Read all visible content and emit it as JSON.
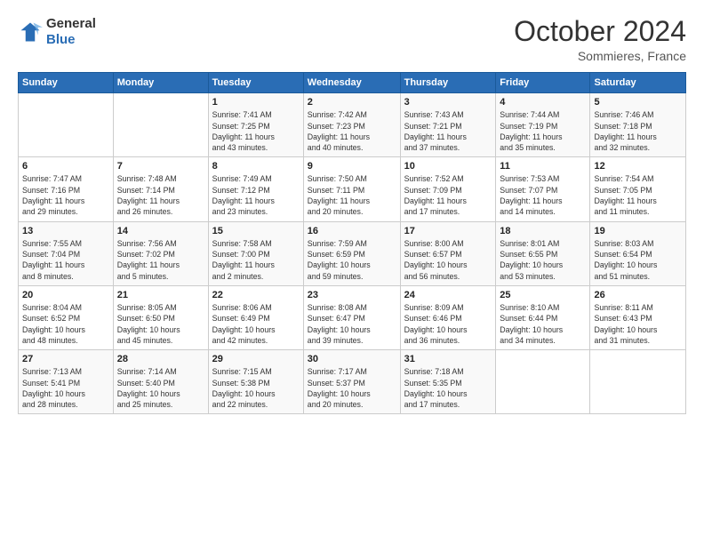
{
  "header": {
    "logo": {
      "general": "General",
      "blue": "Blue"
    },
    "title": "October 2024",
    "location": "Sommieres, France"
  },
  "days_of_week": [
    "Sunday",
    "Monday",
    "Tuesday",
    "Wednesday",
    "Thursday",
    "Friday",
    "Saturday"
  ],
  "weeks": [
    [
      {
        "day": "",
        "info": ""
      },
      {
        "day": "",
        "info": ""
      },
      {
        "day": "1",
        "info": "Sunrise: 7:41 AM\nSunset: 7:25 PM\nDaylight: 11 hours\nand 43 minutes."
      },
      {
        "day": "2",
        "info": "Sunrise: 7:42 AM\nSunset: 7:23 PM\nDaylight: 11 hours\nand 40 minutes."
      },
      {
        "day": "3",
        "info": "Sunrise: 7:43 AM\nSunset: 7:21 PM\nDaylight: 11 hours\nand 37 minutes."
      },
      {
        "day": "4",
        "info": "Sunrise: 7:44 AM\nSunset: 7:19 PM\nDaylight: 11 hours\nand 35 minutes."
      },
      {
        "day": "5",
        "info": "Sunrise: 7:46 AM\nSunset: 7:18 PM\nDaylight: 11 hours\nand 32 minutes."
      }
    ],
    [
      {
        "day": "6",
        "info": "Sunrise: 7:47 AM\nSunset: 7:16 PM\nDaylight: 11 hours\nand 29 minutes."
      },
      {
        "day": "7",
        "info": "Sunrise: 7:48 AM\nSunset: 7:14 PM\nDaylight: 11 hours\nand 26 minutes."
      },
      {
        "day": "8",
        "info": "Sunrise: 7:49 AM\nSunset: 7:12 PM\nDaylight: 11 hours\nand 23 minutes."
      },
      {
        "day": "9",
        "info": "Sunrise: 7:50 AM\nSunset: 7:11 PM\nDaylight: 11 hours\nand 20 minutes."
      },
      {
        "day": "10",
        "info": "Sunrise: 7:52 AM\nSunset: 7:09 PM\nDaylight: 11 hours\nand 17 minutes."
      },
      {
        "day": "11",
        "info": "Sunrise: 7:53 AM\nSunset: 7:07 PM\nDaylight: 11 hours\nand 14 minutes."
      },
      {
        "day": "12",
        "info": "Sunrise: 7:54 AM\nSunset: 7:05 PM\nDaylight: 11 hours\nand 11 minutes."
      }
    ],
    [
      {
        "day": "13",
        "info": "Sunrise: 7:55 AM\nSunset: 7:04 PM\nDaylight: 11 hours\nand 8 minutes."
      },
      {
        "day": "14",
        "info": "Sunrise: 7:56 AM\nSunset: 7:02 PM\nDaylight: 11 hours\nand 5 minutes."
      },
      {
        "day": "15",
        "info": "Sunrise: 7:58 AM\nSunset: 7:00 PM\nDaylight: 11 hours\nand 2 minutes."
      },
      {
        "day": "16",
        "info": "Sunrise: 7:59 AM\nSunset: 6:59 PM\nDaylight: 10 hours\nand 59 minutes."
      },
      {
        "day": "17",
        "info": "Sunrise: 8:00 AM\nSunset: 6:57 PM\nDaylight: 10 hours\nand 56 minutes."
      },
      {
        "day": "18",
        "info": "Sunrise: 8:01 AM\nSunset: 6:55 PM\nDaylight: 10 hours\nand 53 minutes."
      },
      {
        "day": "19",
        "info": "Sunrise: 8:03 AM\nSunset: 6:54 PM\nDaylight: 10 hours\nand 51 minutes."
      }
    ],
    [
      {
        "day": "20",
        "info": "Sunrise: 8:04 AM\nSunset: 6:52 PM\nDaylight: 10 hours\nand 48 minutes."
      },
      {
        "day": "21",
        "info": "Sunrise: 8:05 AM\nSunset: 6:50 PM\nDaylight: 10 hours\nand 45 minutes."
      },
      {
        "day": "22",
        "info": "Sunrise: 8:06 AM\nSunset: 6:49 PM\nDaylight: 10 hours\nand 42 minutes."
      },
      {
        "day": "23",
        "info": "Sunrise: 8:08 AM\nSunset: 6:47 PM\nDaylight: 10 hours\nand 39 minutes."
      },
      {
        "day": "24",
        "info": "Sunrise: 8:09 AM\nSunset: 6:46 PM\nDaylight: 10 hours\nand 36 minutes."
      },
      {
        "day": "25",
        "info": "Sunrise: 8:10 AM\nSunset: 6:44 PM\nDaylight: 10 hours\nand 34 minutes."
      },
      {
        "day": "26",
        "info": "Sunrise: 8:11 AM\nSunset: 6:43 PM\nDaylight: 10 hours\nand 31 minutes."
      }
    ],
    [
      {
        "day": "27",
        "info": "Sunrise: 7:13 AM\nSunset: 5:41 PM\nDaylight: 10 hours\nand 28 minutes."
      },
      {
        "day": "28",
        "info": "Sunrise: 7:14 AM\nSunset: 5:40 PM\nDaylight: 10 hours\nand 25 minutes."
      },
      {
        "day": "29",
        "info": "Sunrise: 7:15 AM\nSunset: 5:38 PM\nDaylight: 10 hours\nand 22 minutes."
      },
      {
        "day": "30",
        "info": "Sunrise: 7:17 AM\nSunset: 5:37 PM\nDaylight: 10 hours\nand 20 minutes."
      },
      {
        "day": "31",
        "info": "Sunrise: 7:18 AM\nSunset: 5:35 PM\nDaylight: 10 hours\nand 17 minutes."
      },
      {
        "day": "",
        "info": ""
      },
      {
        "day": "",
        "info": ""
      }
    ]
  ]
}
